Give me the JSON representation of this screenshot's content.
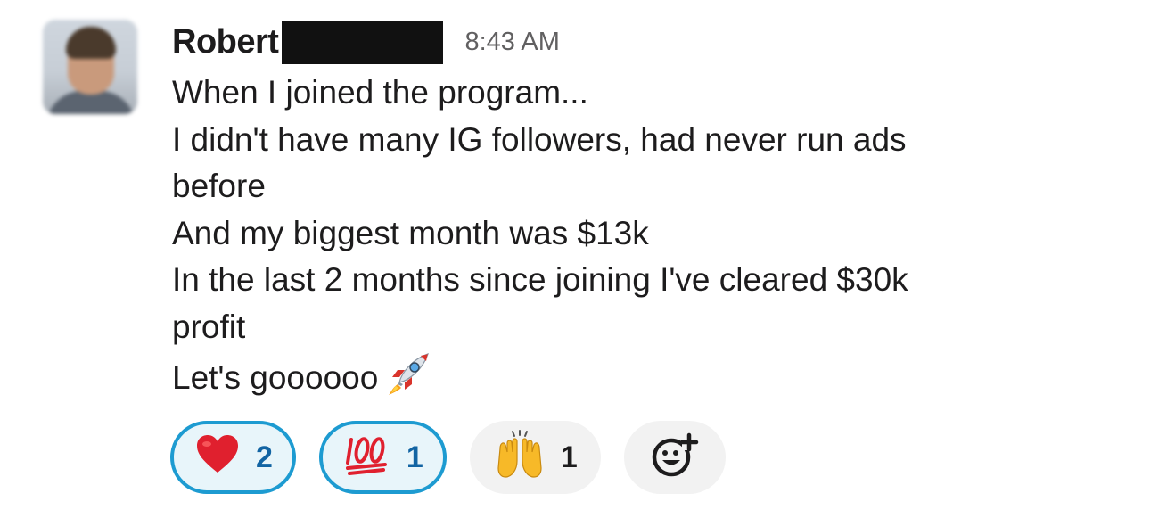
{
  "message": {
    "sender_name": "Robert",
    "timestamp": "8:43 AM",
    "lines": [
      "When I joined the program...",
      "I didn't have many IG followers, had never run ads",
      "before",
      "And my biggest month was $13k",
      "In the last 2 months since joining I've cleared $30k",
      "profit",
      "Let's goooooo"
    ],
    "trailing_emoji": "rocket-icon"
  },
  "reactions": [
    {
      "emoji": "red-heart-icon",
      "count": "2",
      "selected": true
    },
    {
      "emoji": "hundred-points-icon",
      "count": "1",
      "selected": true
    },
    {
      "emoji": "raising-hands-icon",
      "count": "1",
      "selected": false
    }
  ],
  "add_reaction": {
    "icon": "add-reaction-smiley-icon"
  },
  "colors": {
    "selected_border": "#1d9bd1",
    "selected_bg": "#e8f5fa",
    "selected_text": "#1264a3",
    "unselected_bg": "#f2f2f2",
    "text": "#1d1c1d",
    "timestamp": "#616061"
  }
}
